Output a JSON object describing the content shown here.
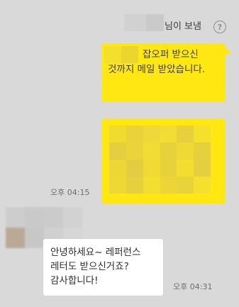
{
  "header": {
    "sender_suffix": "님이 보냄",
    "help_glyph": "?"
  },
  "messages": [
    {
      "direction": "outgoing",
      "text": "잡오퍼 받으신 것까지 메일 받았습니다.",
      "time": "오후 04:15"
    },
    {
      "direction": "outgoing",
      "type": "image",
      "content": "pixelated image"
    },
    {
      "direction": "incoming",
      "text": "안녕하세요~ 레퍼런스 레터도 받으신거죠? 감사합니다!",
      "time": "오후 04:31"
    }
  ],
  "colors": {
    "background": "#d9d9d9",
    "outgoing_bubble": "#ffe812",
    "incoming_bubble": "#ffffff",
    "time_text": "#6e6e6e"
  },
  "image_tiles": [
    "#f0dc2e",
    "#e9d33a",
    "#eed83a",
    "#f2dd34",
    "#e6d13d",
    "#f5e02c",
    "#e3cf3f",
    "#ead43a",
    "#f1dc33",
    "#e7d23c",
    "#efd935",
    "#e5d03e",
    "#ecd737",
    "#e2ce40",
    "#f0da33",
    "#e8d23b",
    "#f3de30",
    "#e4cf3f",
    "#eed835",
    "#e6d13c",
    "#f2dd31",
    "#ecd637",
    "#e9d33a",
    "#f4e02d"
  ],
  "avatar_tiles": [
    "#cdcdcd",
    "#c9c9c9",
    "#cbcbcb",
    "#d2d2d2",
    "#b9a892",
    "#c7c7c7",
    "#d0d0d0",
    "#d6d6d6"
  ]
}
